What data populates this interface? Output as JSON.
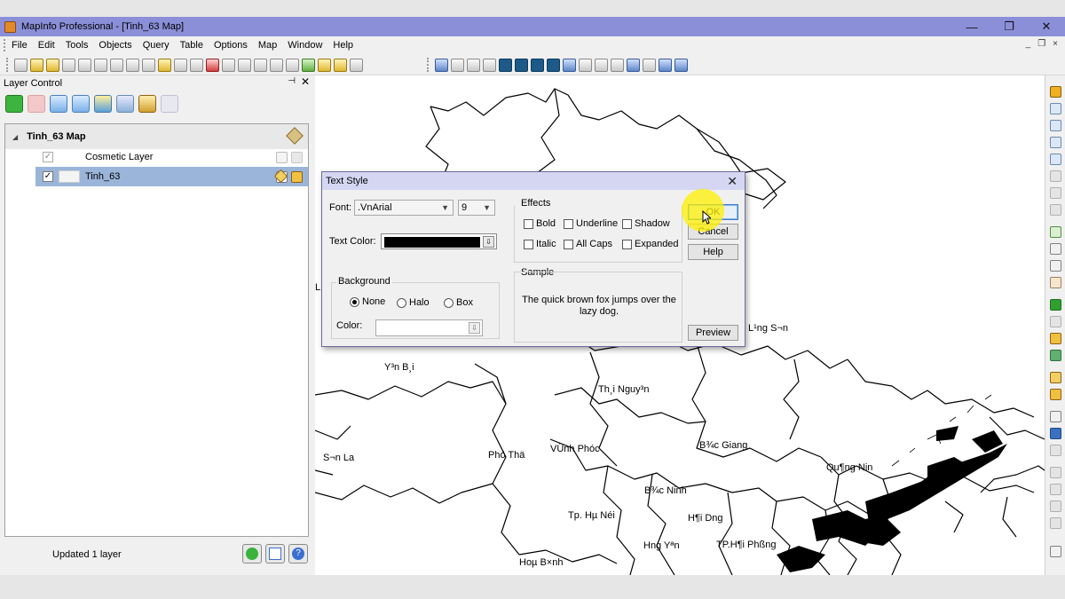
{
  "window": {
    "title": "MapInfo Professional - [Tinh_63 Map]",
    "controls": [
      "—",
      "❐",
      "✕"
    ]
  },
  "menu": {
    "items": [
      "File",
      "Edit",
      "Tools",
      "Objects",
      "Query",
      "Table",
      "Options",
      "Map",
      "Window",
      "Help"
    ],
    "mdi_controls": [
      "_",
      "❐",
      "×"
    ]
  },
  "layer_control": {
    "title": "Layer Control",
    "pin": "⊣",
    "close": "✕",
    "map_name": "Tinh_63 Map",
    "layers": [
      {
        "name": "Cosmetic Layer",
        "checked": true
      },
      {
        "name": "Tinh_63",
        "checked": true
      }
    ],
    "status": "Updated 1 layer"
  },
  "dialog": {
    "title": "Text Style",
    "close": "✕",
    "font_label": "Font:",
    "font_value": ".VnArial",
    "size_value": "9",
    "text_color_label": "Text Color:",
    "text_color": "#000000",
    "background": {
      "label": "Background",
      "options": [
        "None",
        "Halo",
        "Box"
      ],
      "selected": "None",
      "color_label": "Color:"
    },
    "effects": {
      "label": "Effects",
      "options": [
        "Bold",
        "Underline",
        "Shadow",
        "Italic",
        "All Caps",
        "Expanded"
      ]
    },
    "sample": {
      "label": "Sample",
      "text": "The quick brown fox jumps over the lazy dog."
    },
    "buttons": {
      "ok": "OK",
      "cancel": "Cancel",
      "help": "Help",
      "preview": "Preview"
    }
  },
  "map": {
    "labels": [
      {
        "text": "L",
        "cls": "l1"
      },
      {
        "text": "Y³n B¸i",
        "cls": "l2"
      },
      {
        "text": "L¹ng S¬n",
        "cls": "l3"
      },
      {
        "text": "Th¸i Nguy³n",
        "cls": "l4"
      },
      {
        "text": "S¬n La",
        "cls": "l5"
      },
      {
        "text": "Phó Thä",
        "cls": "l6"
      },
      {
        "text": "VÜnh Phóc",
        "cls": "l7"
      },
      {
        "text": "B¾c Giang",
        "cls": "l8"
      },
      {
        "text": "Qu¶ng Nin",
        "cls": "l9"
      },
      {
        "text": "B¾c Ninh",
        "cls": "l10"
      },
      {
        "text": "Tp. Hµ Néi",
        "cls": "l11"
      },
      {
        "text": "H¶i D­ng",
        "cls": "l12"
      },
      {
        "text": "Hng Yªn",
        "cls": "l13"
      },
      {
        "text": "TP.H¶i Phßng",
        "cls": "l14"
      },
      {
        "text": "Hoµ B×nh",
        "cls": "l15"
      }
    ]
  },
  "colors": {
    "titlebar": "#8b8fd8",
    "selection": "#9bb5da",
    "ok_focus": "#3c7fd0",
    "highlight": "#fff000"
  }
}
